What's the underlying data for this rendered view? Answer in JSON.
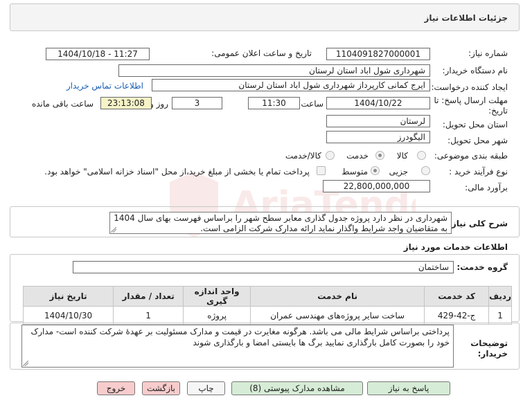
{
  "header": {
    "title": "جزئیات اطلاعات نیاز"
  },
  "fields": {
    "need_number_label": "شماره نیاز:",
    "need_number": "1104091827000001",
    "announce_label": "تاریخ و ساعت اعلان عمومی:",
    "announce_value": "1404/10/18 - 11:27",
    "buyer_org_label": "نام دستگاه خریدار:",
    "buyer_org": "شهرداری شول اباد استان لرستان",
    "creator_label": "ایجاد کننده درخواست:",
    "creator": "ایرج کمانی کارپرداز شهرداری شول اباد استان لرستان",
    "contact_link": "اطلاعات تماس خریدار",
    "deadline_label_1": "مهلت ارسال پاسخ: تا",
    "deadline_label_2": "تاریخ:",
    "deadline_date": "1404/10/22",
    "time_label": "ساعت",
    "deadline_time": "11:30",
    "days_value": "3",
    "days_label": "روز و",
    "remaining_time": "23:13:08",
    "remaining_label": "ساعت باقی مانده",
    "province_label": "استان محل تحویل:",
    "province": "لرستان",
    "city_label": "شهر محل تحویل:",
    "city": "الیگودرز",
    "category_label": "طبقه بندی موضوعی:",
    "category_options": [
      "کالا",
      "خدمت",
      "کالا/خدمت"
    ],
    "category_selected": "خدمت",
    "process_label": "نوع فرآیند خرید :",
    "process_options": [
      "جزیی",
      "متوسط"
    ],
    "process_selected": "متوسط",
    "payment_note": "پرداخت تمام یا بخشی از مبلغ خرید،از محل \"اسناد خزانه اسلامی\" خواهد بود.",
    "estimate_label": "برآورد مالی:",
    "estimate": "22,800,000,000"
  },
  "summary": {
    "label": "شرح کلی نیاز:",
    "text": "شهرداری در نظر دارد پروژه جدول گذاری معابر سطح شهر را براساس فهرست بهای سال 1404 به متقاضیان واجد شرایط واگذار نماید ارائه مدارک شرکت الزامی است."
  },
  "services": {
    "section_title": "اطلاعات خدمات مورد نیاز",
    "group_label": "گروه خدمت:",
    "group_value": "ساختمان",
    "columns": [
      "ردیف",
      "کد خدمت",
      "نام خدمت",
      "واحد اندازه گیری",
      "تعداد / مقدار",
      "تاریخ نیاز"
    ],
    "rows": [
      [
        "1",
        "ج-42-429",
        "ساخت سایر پروژه‌های مهندسی عمران",
        "پروژه",
        "1",
        "1404/10/30"
      ]
    ]
  },
  "buyer_notes": {
    "label_1": "توضیحات",
    "label_2": "خریدار:",
    "text": "پرداختی براساس شرایط مالی می باشد. هرگونه مغایرت در قیمت و مدارک مسئولیت بر عهدهٔ شرکت کننده است- مدارک خود را بصورت کامل بارگذاری نمایید برگ ها بایستی امضا و بارگذاری شوند"
  },
  "buttons": {
    "reply": "پاسخ به نیاز",
    "view_docs": "مشاهده مدارک پیوستی (8)",
    "print": "چاپ",
    "back": "بازگشت",
    "exit": "خروج"
  },
  "watermark": "AriaTender.net",
  "colors": {
    "link": "#1a5fb4",
    "time_highlight": "#f5f3c7",
    "btn_green": "#d6ecd6",
    "btn_red": "#f8cccc"
  }
}
